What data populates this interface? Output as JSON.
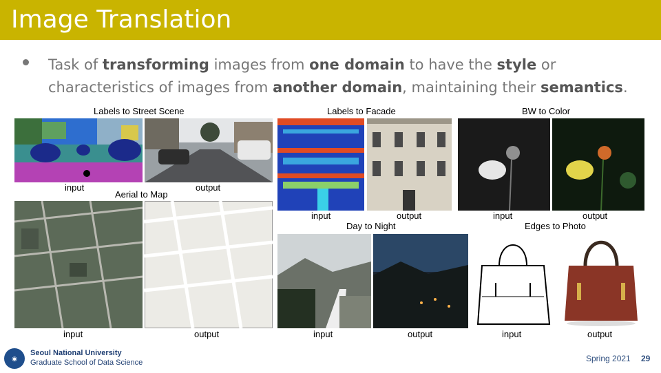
{
  "slide": {
    "title": "Image Translation",
    "bullet_parts": [
      {
        "text": "Task of ",
        "bold": false
      },
      {
        "text": "transforming",
        "bold": true
      },
      {
        "text": " images from ",
        "bold": false
      },
      {
        "text": "one domain",
        "bold": true
      },
      {
        "text": " to have the ",
        "bold": false
      },
      {
        "text": "style",
        "bold": true
      },
      {
        "text": " or characteristics of images from ",
        "bold": false
      },
      {
        "text": "another domain",
        "bold": true
      },
      {
        "text": ", maintaining their ",
        "bold": false
      },
      {
        "text": "semantics",
        "bold": true
      },
      {
        "text": ".",
        "bold": false
      }
    ]
  },
  "figure": {
    "labels_to_street": "Labels to Street Scene",
    "labels_to_facade": "Labels to Facade",
    "bw_to_color": "BW to Color",
    "aerial_to_map": "Aerial to Map",
    "day_to_night": "Day to Night",
    "edges_to_photo": "Edges to Photo",
    "input": "input",
    "output": "output"
  },
  "footer": {
    "university": "Seoul National University",
    "school": "Graduate School of Data Science",
    "term": "Spring 2021",
    "page": "29"
  }
}
